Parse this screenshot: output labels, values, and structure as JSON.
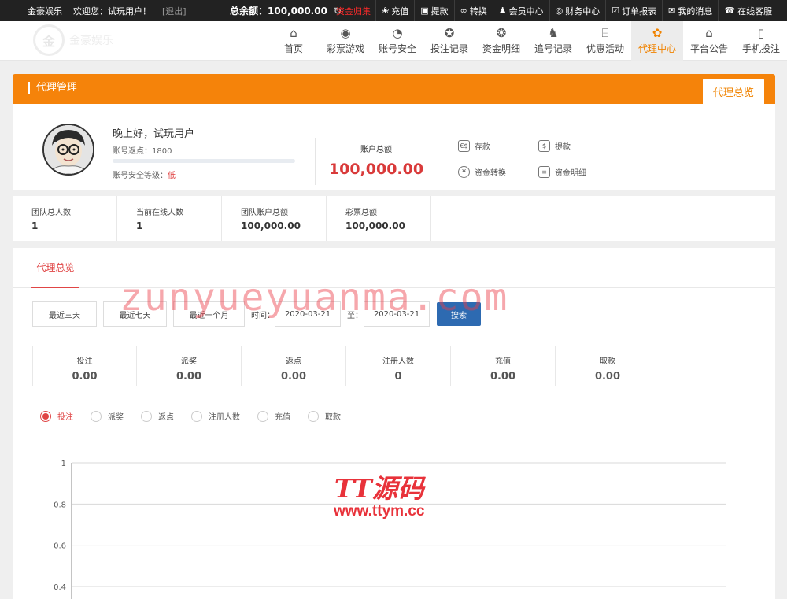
{
  "topbar": {
    "brand": "金豪娱乐",
    "welcome": "欢迎您：试玩用户！",
    "logout": "[退出]",
    "balance_label": "总余额：",
    "balance_value": "100,000.00",
    "links": [
      {
        "label": "资金归集",
        "icon": "",
        "hot": true
      },
      {
        "label": "充值",
        "icon": "❀"
      },
      {
        "label": "提款",
        "icon": "▣"
      },
      {
        "label": "转换",
        "icon": "∞"
      },
      {
        "label": "会员中心",
        "icon": "♟"
      },
      {
        "label": "财务中心",
        "icon": "◎"
      },
      {
        "label": "订单报表",
        "icon": "☑"
      },
      {
        "label": "我的消息",
        "icon": "✉"
      },
      {
        "label": "在线客服",
        "icon": "☎"
      }
    ]
  },
  "nav": {
    "items": [
      {
        "label": "首页",
        "icon": "⌂"
      },
      {
        "label": "彩票游戏",
        "icon": "◉"
      },
      {
        "label": "账号安全",
        "icon": "◔"
      },
      {
        "label": "投注记录",
        "icon": "✪"
      },
      {
        "label": "资金明细",
        "icon": "❂"
      },
      {
        "label": "追号记录",
        "icon": "♞"
      },
      {
        "label": "优惠活动",
        "icon": "⌸"
      },
      {
        "label": "代理中心",
        "icon": "✿",
        "active": true
      },
      {
        "label": "平台公告",
        "icon": "⌂"
      },
      {
        "label": "手机投注",
        "icon": "▯"
      }
    ]
  },
  "panel": {
    "title": "代理管理",
    "tab": "代理总览"
  },
  "profile": {
    "greeting": "晚上好，试玩用户",
    "rebate_label": "账号返点：",
    "rebate_value": "1800",
    "security_label": "账号安全等级：",
    "security_value": "低",
    "security_progress": 0.0,
    "balance_label": "账户总额",
    "balance_value": "100,000.00",
    "actions": [
      {
        "label": "存款",
        "icon": "€$"
      },
      {
        "label": "提款",
        "icon": "$"
      },
      {
        "label": "资金转换",
        "icon": "¥"
      },
      {
        "label": "资金明细",
        "icon": "≡"
      }
    ]
  },
  "team": [
    {
      "label": "团队总人数",
      "value": "1"
    },
    {
      "label": "当前在线人数",
      "value": "1"
    },
    {
      "label": "团队账户总额",
      "value": "100,000.00"
    },
    {
      "label": "彩票总额",
      "value": "100,000.00"
    }
  ],
  "overview": {
    "tab": "代理总览",
    "filters": {
      "btn_3days": "最近三天",
      "btn_7days": "最近七天",
      "btn_month": "最近一个月",
      "time_label": "时间：",
      "date_from": "2020-03-21",
      "to_label": "至：",
      "date_to": "2020-03-21",
      "search": "搜索"
    },
    "stats": [
      {
        "label": "投注",
        "value": "0.00"
      },
      {
        "label": "派奖",
        "value": "0.00"
      },
      {
        "label": "返点",
        "value": "0.00"
      },
      {
        "label": "注册人数",
        "value": "0"
      },
      {
        "label": "充值",
        "value": "0.00"
      },
      {
        "label": "取款",
        "value": "0.00"
      }
    ],
    "series_options": [
      {
        "label": "投注",
        "checked": true
      },
      {
        "label": "派奖"
      },
      {
        "label": "返点"
      },
      {
        "label": "注册人数"
      },
      {
        "label": "充值"
      },
      {
        "label": "取款"
      }
    ]
  },
  "chart_data": {
    "type": "line",
    "y_ticks": [
      "1",
      "0.8",
      "0.6",
      "0.4"
    ],
    "ylim": [
      0.4,
      1
    ],
    "grid": true,
    "series": []
  },
  "watermarks": {
    "text1": "zunyueyuanma.com",
    "text2a": "TT源码",
    "text2b": "www.ttym.cc"
  },
  "colors": {
    "accent": "#f5830a",
    "alert": "#d93a3a",
    "search_button": "#2d6ab1"
  }
}
